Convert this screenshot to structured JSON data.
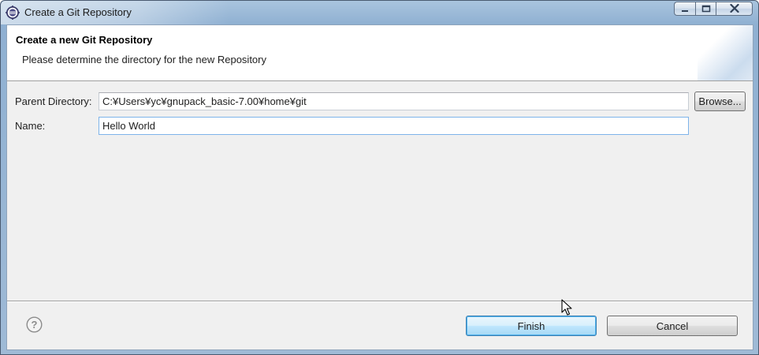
{
  "window": {
    "title": "Create a Git Repository"
  },
  "header": {
    "title": "Create a new Git Repository",
    "description": "Please determine the directory for the new Repository"
  },
  "form": {
    "parent_directory": {
      "label": "Parent Directory:",
      "value": "C:¥Users¥yc¥gnupack_basic-7.00¥home¥git",
      "browse_label": "Browse..."
    },
    "name": {
      "label": "Name:",
      "value": "Hello World"
    }
  },
  "footer": {
    "help_icon": "help-icon",
    "finish_label": "Finish",
    "cancel_label": "Cancel"
  },
  "colors": {
    "accent": "#3c7fb1",
    "focus_border": "#7eb4ea",
    "dialog_bg": "#f0f0f0"
  }
}
